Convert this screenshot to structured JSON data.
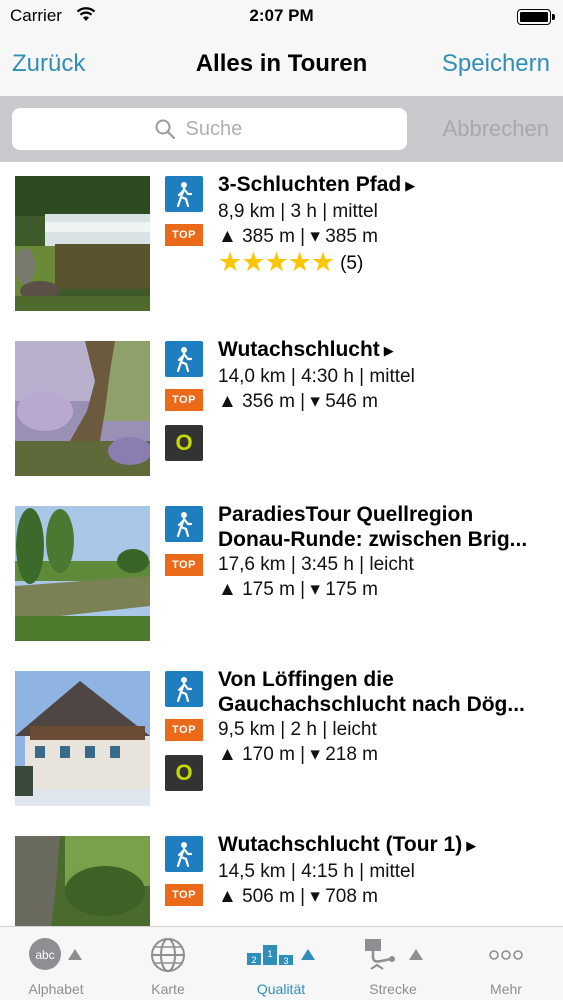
{
  "status_bar": {
    "carrier": "Carrier",
    "time": "2:07 PM"
  },
  "nav": {
    "back": "Zurück",
    "title": "Alles in Touren",
    "save": "Speichern"
  },
  "search": {
    "placeholder": "Suche",
    "cancel": "Abbrechen"
  },
  "tours": [
    {
      "title": "3-Schluchten Pfad",
      "meta": "8,9 km | 3 h | mittel",
      "elevation": "▲ 385 m | ▾ 385 m",
      "badge_top": "TOP",
      "rating_stars": 5,
      "rating_count": "(5)"
    },
    {
      "title": "Wutachschlucht",
      "meta": "14,0 km | 4:30 h | mittel",
      "elevation": "▲ 356 m | ▾ 546 m",
      "badge_top": "TOP",
      "badge_o": "O"
    },
    {
      "title": "ParadiesTour Quellregion",
      "title2": "Donau-Runde: zwischen Brig...",
      "meta": "17,6 km | 3:45 h | leicht",
      "elevation": "▲ 175 m | ▾ 175 m",
      "badge_top": "TOP"
    },
    {
      "title": "Von Löffingen die",
      "title2": "Gauchachschlucht nach Dög...",
      "meta": "9,5 km | 2 h | leicht",
      "elevation": "▲ 170 m | ▾ 218 m",
      "badge_top": "TOP",
      "badge_o": "O"
    },
    {
      "title": "Wutachschlucht (Tour 1)",
      "meta": "14,5 km | 4:15 h | mittel",
      "elevation": "▲ 506 m | ▾ 708 m",
      "badge_top": "TOP"
    }
  ],
  "tabs": [
    {
      "label": "Alphabet",
      "icon": "abc-icon"
    },
    {
      "label": "Karte",
      "icon": "globe-icon"
    },
    {
      "label": "Qualität",
      "icon": "podium-icon",
      "active": true
    },
    {
      "label": "Strecke",
      "icon": "route-icon"
    },
    {
      "label": "Mehr",
      "icon": "more-icon"
    }
  ],
  "colors": {
    "accent": "#2f8fb9",
    "hike_badge": "#1f7ec0",
    "top_badge": "#ea6a1a",
    "star": "#fdc600"
  }
}
